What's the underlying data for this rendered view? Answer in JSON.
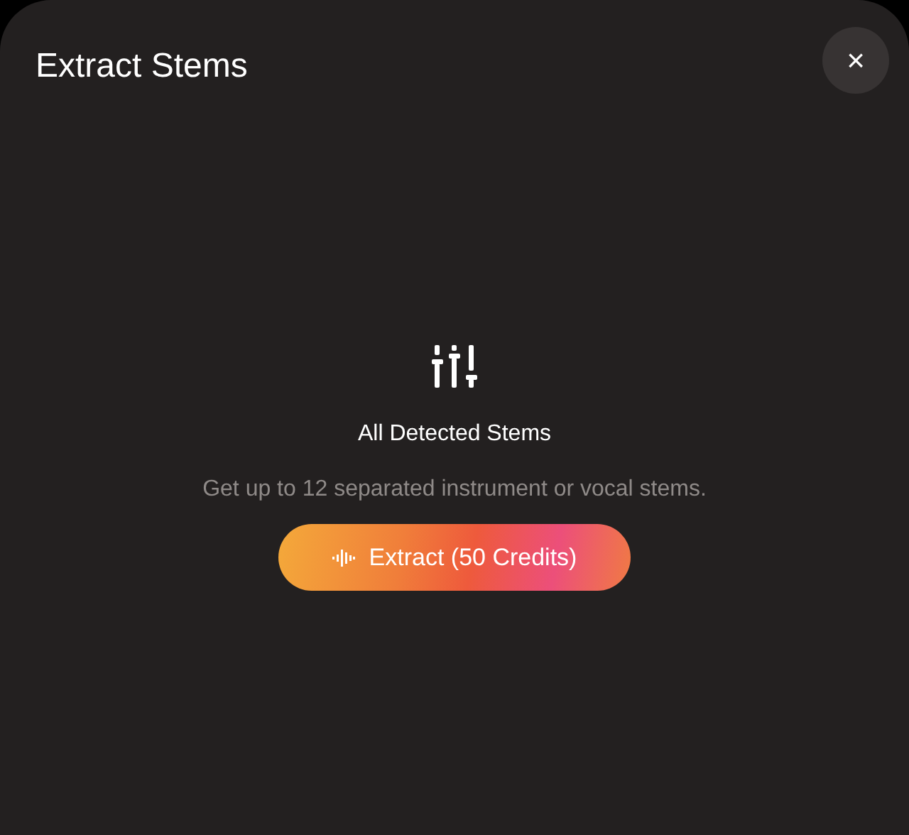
{
  "dialog": {
    "title": "Extract Stems",
    "close_label": "×"
  },
  "option": {
    "heading": "All Detected Stems",
    "description": "Get up to 12 separated instrument or vocal stems."
  },
  "action_button": {
    "label": "Extract (50 Credits)"
  }
}
